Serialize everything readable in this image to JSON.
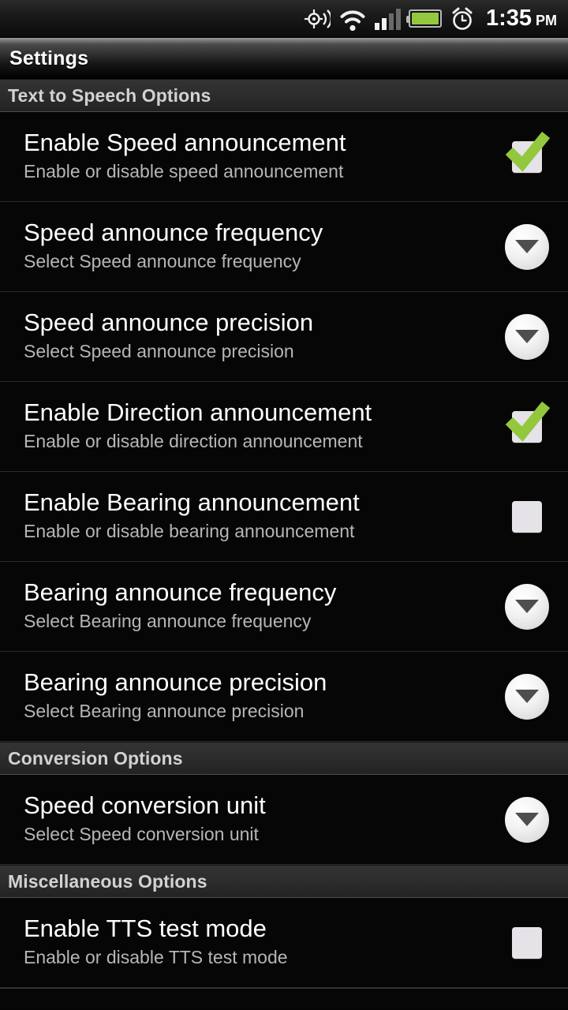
{
  "statusbar": {
    "icons": [
      {
        "name": "gps-icon",
        "label": "GPS"
      },
      {
        "name": "wifi-icon",
        "label": "Wi-Fi"
      },
      {
        "name": "cellular-signal-icon",
        "label": "Signal",
        "bars_on": 2,
        "bars_total": 4
      },
      {
        "name": "battery-icon",
        "label": "Battery",
        "level_percent": 100
      },
      {
        "name": "alarm-clock-icon",
        "label": "Alarm"
      }
    ],
    "time": "1:35",
    "ampm": "PM"
  },
  "titlebar": {
    "title": "Settings"
  },
  "colors": {
    "accent_green": "#93c83e",
    "checkbox_fill": "#e6e3e8",
    "section_header_bg": "#2b2b2b",
    "background": "#060606",
    "title_text": "#ffffff",
    "summary_text": "#b6b6b6"
  },
  "sections": [
    {
      "header": "Text to Speech Options",
      "rows": [
        {
          "title": "Enable Speed announcement",
          "summary": "Enable or disable speed announcement",
          "widget": "checkbox",
          "checked": true
        },
        {
          "title": "Speed announce frequency",
          "summary": "Select Speed announce frequency",
          "widget": "spinner",
          "checked": false
        },
        {
          "title": "Speed announce precision",
          "summary": "Select Speed announce precision",
          "widget": "spinner",
          "checked": false
        },
        {
          "title": "Enable Direction announcement",
          "summary": "Enable or disable direction announcement",
          "widget": "checkbox",
          "checked": true
        },
        {
          "title": "Enable Bearing announcement",
          "summary": "Enable or disable bearing announcement",
          "widget": "checkbox",
          "checked": false
        },
        {
          "title": "Bearing announce frequency",
          "summary": "Select Bearing announce frequency",
          "widget": "spinner",
          "checked": false
        },
        {
          "title": "Bearing announce precision",
          "summary": "Select Bearing announce precision",
          "widget": "spinner",
          "checked": false
        }
      ]
    },
    {
      "header": "Conversion Options",
      "rows": [
        {
          "title": "Speed conversion unit",
          "summary": "Select Speed conversion unit",
          "widget": "spinner",
          "checked": false
        }
      ]
    },
    {
      "header": "Miscellaneous Options",
      "rows": [
        {
          "title": "Enable TTS test mode",
          "summary": "Enable or disable TTS test mode",
          "widget": "checkbox",
          "checked": false
        }
      ]
    }
  ]
}
